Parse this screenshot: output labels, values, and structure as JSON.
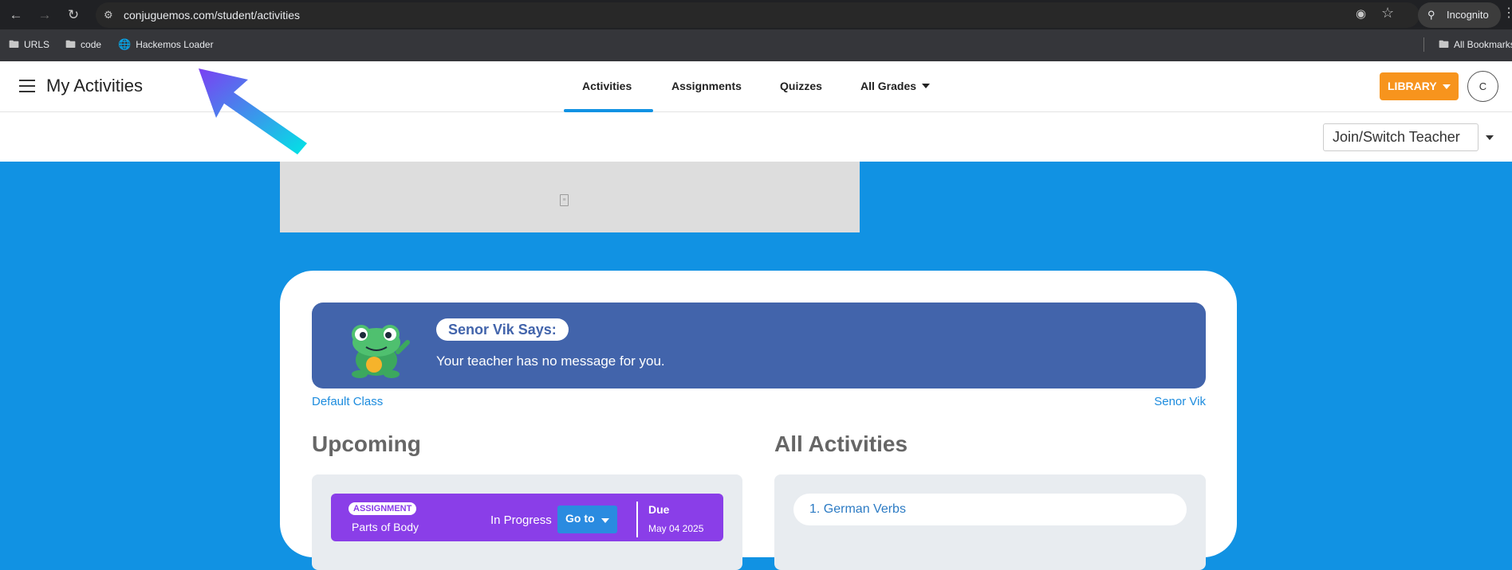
{
  "browser": {
    "url": "conjuguemos.com/student/activities",
    "incognito_label": "Incognito",
    "bookmarks": [
      "URLS",
      "code",
      "Hackemos Loader"
    ],
    "all_bookmarks_label": "All Bookmarks"
  },
  "header": {
    "title": "My Activities",
    "tabs": [
      "Activities",
      "Assignments",
      "Quizzes",
      "All Grades"
    ],
    "active_tab": "Activities",
    "library_label": "LIBRARY",
    "avatar_initial": "C"
  },
  "subheader": {
    "join_label": "Join/Switch Teacher"
  },
  "message": {
    "says_label": "Senor Vik Says:",
    "text": "Your teacher has no message for you.",
    "class_link": "Default Class",
    "teacher_link": "Senor Vik"
  },
  "upcoming": {
    "title": "Upcoming",
    "assignment": {
      "badge": "ASSIGNMENT",
      "name": "Parts of Body",
      "status": "In Progress",
      "goto_label": "Go to",
      "due_label": "Due",
      "due_date": "May 04 2025"
    }
  },
  "all_activities": {
    "title": "All Activities",
    "items": [
      "1. German Verbs"
    ]
  },
  "colors": {
    "background_blue": "#1192e3",
    "library_orange": "#f7941d",
    "message_blue": "#4264ab",
    "assignment_purple": "#8a3ee8",
    "arrow_gradient": [
      "#7b3ff2",
      "#00e5e5"
    ]
  }
}
